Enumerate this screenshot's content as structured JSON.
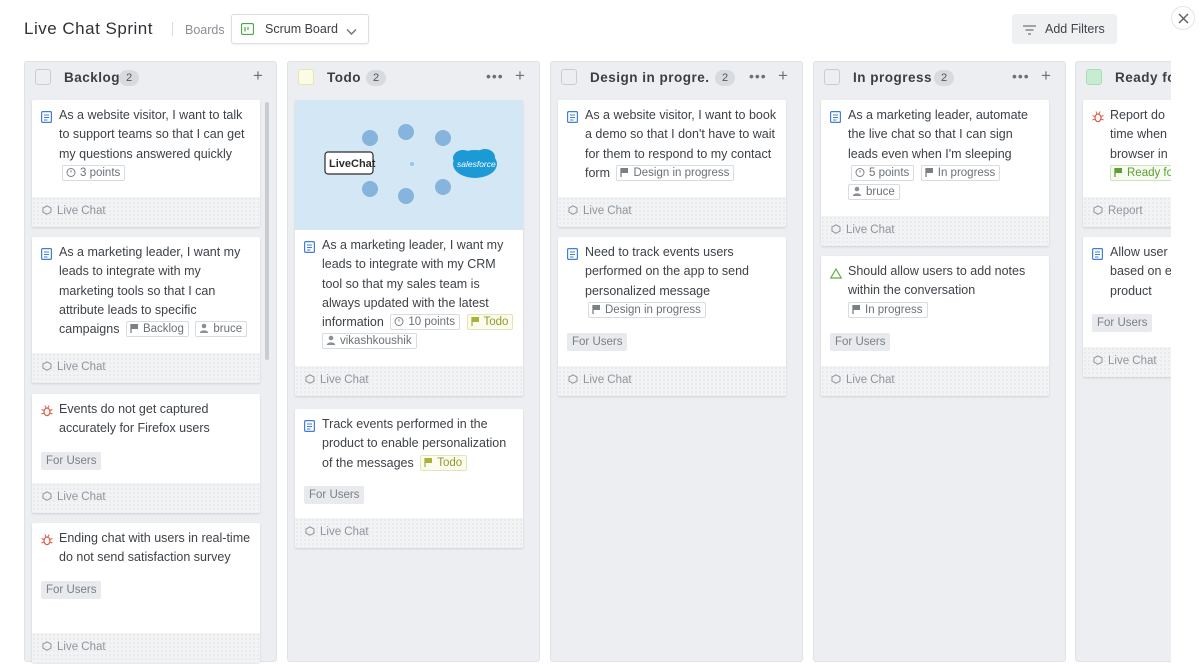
{
  "header": {
    "sprint_title": "Live Chat Sprint",
    "boards_label": "Boards",
    "board_select": "Scrum Board",
    "filters_label": "Add Filters"
  },
  "colors": {
    "column_bg": "#eceef1",
    "story_icon": "#3f7fd8",
    "bug_icon": "#e05a4a",
    "task_icon": "#5fae3e",
    "ready_column": "#c7ecd2",
    "todo_column": "#fbfbe8"
  },
  "columns": [
    {
      "title": "Backlog",
      "count": "2",
      "cards": [
        {
          "icon": "story-icon",
          "title": "As a website visitor, I want to talk to support teams so that I can get my questions answered quickly",
          "tags": [
            "3 points"
          ],
          "project": "Live Chat"
        },
        {
          "icon": "story-icon",
          "title": "As a marketing leader, I want my leads to integrate with my marketing tools so that I can attribute leads to specific campaigns",
          "tags": [
            "Backlog",
            "bruce"
          ],
          "project": "Live Chat"
        },
        {
          "icon": "bug-icon",
          "title": "Events do not get captured accurately for Firefox users",
          "label": "For Users",
          "project": "Live Chat"
        },
        {
          "icon": "bug-icon",
          "title": "Ending chat with users in real-time do not send satisfaction survey",
          "label": "For Users",
          "project": "Live Chat"
        }
      ]
    },
    {
      "title": "Todo",
      "count": "2",
      "cards": [
        {
          "icon": "story-icon",
          "image_logo": "LiveChat",
          "image_logo2": "salesforce",
          "title": "As a marketing leader, I want my leads to integrate with my CRM tool so that my sales team is always updated with the latest information",
          "tags": [
            "10 points",
            "Todo",
            "vikashkoushik"
          ],
          "project": "Live Chat"
        },
        {
          "icon": "story-icon",
          "title": "Track events performed in the product to enable personalization of the messages",
          "tags": [
            "Todo"
          ],
          "label": "For Users",
          "project": "Live Chat"
        }
      ]
    },
    {
      "title": "Design in progre...",
      "count": "2",
      "cards": [
        {
          "icon": "story-icon",
          "title": "As a website visitor, I want to book a demo so that I don't have to wait for them to respond to my contact form",
          "tags": [
            "Design in progress"
          ],
          "project": "Live Chat"
        },
        {
          "icon": "story-icon",
          "title": "Need to track events users performed on the app to send personalized message",
          "tags": [
            "Design in progress"
          ],
          "label": "For Users",
          "project": "Live Chat"
        }
      ]
    },
    {
      "title": "In progress",
      "count": "2",
      "cards": [
        {
          "icon": "story-icon",
          "title": "As a marketing leader, automate the live chat so that I can sign leads even when I'm sleeping",
          "tags": [
            "5 points",
            "In progress",
            "bruce"
          ],
          "project": "Live Chat"
        },
        {
          "icon": "task-icon",
          "title": "Should allow users to add notes within the conversation",
          "tags": [
            "In progress"
          ],
          "label": "For Users",
          "project": "Live Chat"
        }
      ]
    },
    {
      "title": "Ready fo",
      "cards": [
        {
          "icon": "bug-icon",
          "title_lines": [
            "Report do",
            "time when",
            "browser in"
          ],
          "tags": [
            "Ready fo"
          ],
          "project": "Report"
        },
        {
          "icon": "story-icon",
          "title_lines": [
            "Allow user",
            "based on e",
            "product"
          ],
          "label": "For Users",
          "project": "Live Chat"
        }
      ]
    }
  ]
}
